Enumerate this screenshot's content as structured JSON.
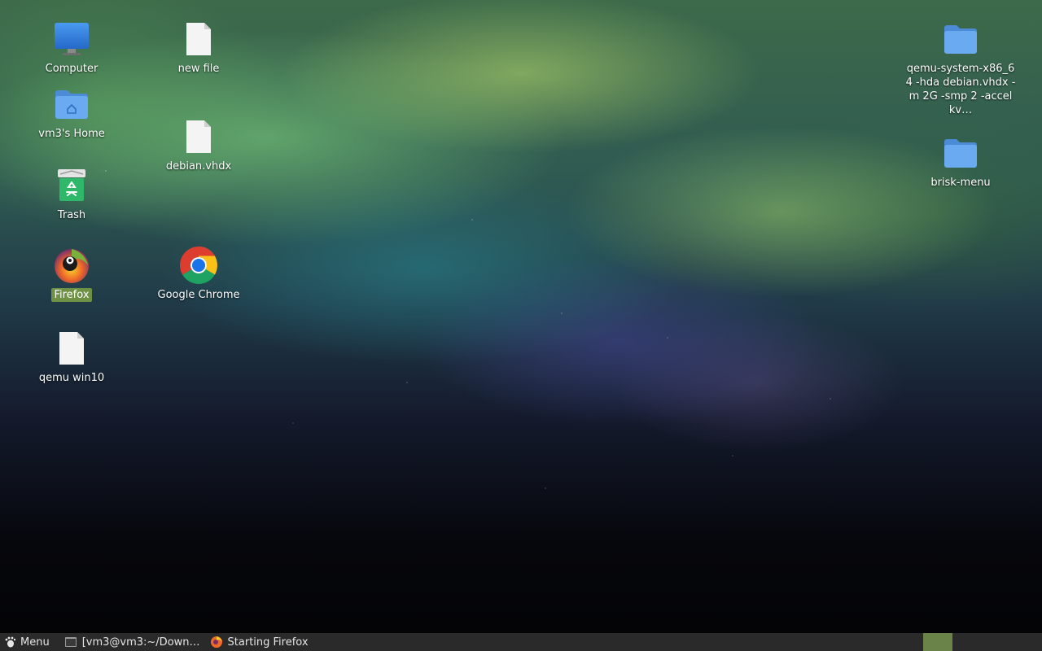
{
  "desktop": {
    "icons": [
      {
        "label": "Computer",
        "kind": "computer-icon"
      },
      {
        "label": "vm3's Home",
        "kind": "home-folder-icon"
      },
      {
        "label": "Trash",
        "kind": "trash-icon"
      },
      {
        "label": "Firefox",
        "kind": "firefox-icon",
        "selected": true
      },
      {
        "label": "qemu win10",
        "kind": "file-icon"
      },
      {
        "label": "new file",
        "kind": "file-icon"
      },
      {
        "label": "debian.vhdx",
        "kind": "file-icon"
      },
      {
        "label": "Google Chrome",
        "kind": "chrome-icon"
      },
      {
        "label": "qemu-system-x86_64 -hda debian.vhdx -m 2G -smp 2 -accel kv…",
        "kind": "folder-icon"
      },
      {
        "label": "brisk-menu",
        "kind": "folder-icon"
      }
    ]
  },
  "taskbar": {
    "menu_label": "Menu",
    "tasks": [
      {
        "label": "[vm3@vm3:~/Down…",
        "kind": "terminal-icon"
      },
      {
        "label": "Starting Firefox",
        "kind": "firefox-icon"
      }
    ]
  },
  "colors": {
    "selection": "#6e9146",
    "taskbar": "#2a2a2a",
    "folder": "#5b9ee8"
  }
}
